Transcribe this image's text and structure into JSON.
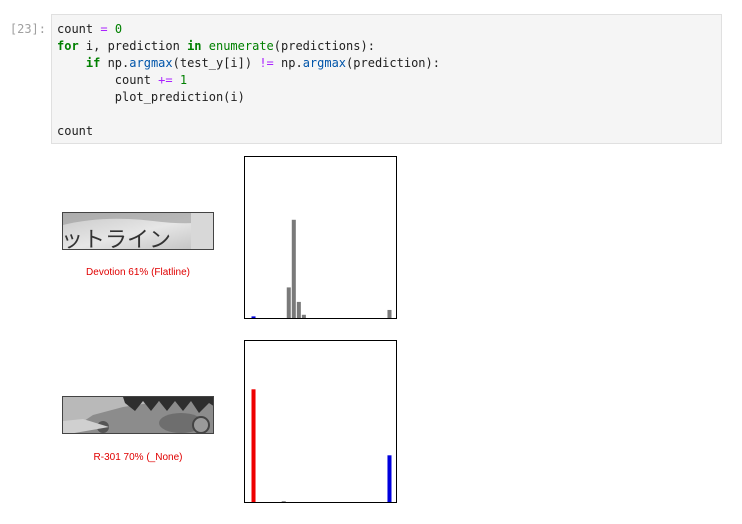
{
  "cell": {
    "prompt": "[23]:",
    "code_lines": [
      [
        {
          "t": "count ",
          "c": ""
        },
        {
          "t": "=",
          "c": "op"
        },
        {
          "t": " ",
          "c": ""
        },
        {
          "t": "0",
          "c": "num"
        }
      ],
      [
        {
          "t": "for",
          "c": "kw"
        },
        {
          "t": " i, prediction ",
          "c": ""
        },
        {
          "t": "in",
          "c": "kw"
        },
        {
          "t": " ",
          "c": ""
        },
        {
          "t": "enumerate",
          "c": "fn"
        },
        {
          "t": "(predictions):",
          "c": ""
        }
      ],
      [
        {
          "t": "    ",
          "c": ""
        },
        {
          "t": "if",
          "c": "kw"
        },
        {
          "t": " np.",
          "c": ""
        },
        {
          "t": "argmax",
          "c": "attr"
        },
        {
          "t": "(test_y[i]) ",
          "c": ""
        },
        {
          "t": "!=",
          "c": "op"
        },
        {
          "t": " np.",
          "c": ""
        },
        {
          "t": "argmax",
          "c": "attr"
        },
        {
          "t": "(prediction):",
          "c": ""
        }
      ],
      [
        {
          "t": "        count ",
          "c": ""
        },
        {
          "t": "+=",
          "c": "op"
        },
        {
          "t": " ",
          "c": ""
        },
        {
          "t": "1",
          "c": "num"
        }
      ],
      [
        {
          "t": "        plot_prediction(i)",
          "c": ""
        }
      ],
      [
        {
          "t": "",
          "c": ""
        }
      ],
      [
        {
          "t": "count",
          "c": ""
        }
      ]
    ]
  },
  "outputs": [
    {
      "caption": "Devotion 61% (Flatline)",
      "thumb_text": "ットライン",
      "bar_colors": [
        "#0000dd",
        "#7a7a7a",
        "#7a7a7a",
        "#7a7a7a",
        "#ee0000",
        "#7a7a7a",
        "#7a7a7a",
        "#7a7a7a",
        "#7a7a7a",
        "#7a7a7a",
        "#7a7a7a",
        "#7a7a7a",
        "#7a7a7a",
        "#7a7a7a",
        "#7a7a7a",
        "#7a7a7a",
        "#7a7a7a",
        "#7a7a7a",
        "#7a7a7a",
        "#7a7a7a",
        "#7a7a7a",
        "#7a7a7a",
        "#7a7a7a",
        "#7a7a7a",
        "#7a7a7a",
        "#7a7a7a",
        "#7a7a7a",
        "#7a7a7a"
      ]
    },
    {
      "caption": "R-301 70% (_None)",
      "thumb_text": "",
      "bar_colors": [
        "#ee0000",
        "#7a7a7a",
        "#7a7a7a",
        "#7a7a7a",
        "#7a7a7a",
        "#7a7a7a",
        "#7a7a7a",
        "#7a7a7a",
        "#7a7a7a",
        "#7a7a7a",
        "#7a7a7a",
        "#7a7a7a",
        "#7a7a7a",
        "#7a7a7a",
        "#7a7a7a",
        "#7a7a7a",
        "#7a7a7a",
        "#7a7a7a",
        "#7a7a7a",
        "#7a7a7a",
        "#7a7a7a",
        "#7a7a7a",
        "#7a7a7a",
        "#7a7a7a",
        "#7a7a7a",
        "#7a7a7a",
        "#7a7a7a",
        "#0000dd"
      ]
    }
  ],
  "chart_data": [
    {
      "type": "bar",
      "n_classes": 28,
      "ylim": [
        0,
        1
      ],
      "values": [
        0.01,
        0,
        0,
        0,
        0,
        0,
        0,
        0.19,
        0.61,
        0.1,
        0.02,
        0,
        0,
        0,
        0,
        0,
        0,
        0,
        0,
        0,
        0,
        0,
        0,
        0,
        0,
        0,
        0,
        0.05
      ],
      "predicted_index": 8,
      "true_index": 0,
      "axes_visible": false
    },
    {
      "type": "bar",
      "n_classes": 28,
      "ylim": [
        0,
        1
      ],
      "values": [
        0.7,
        0,
        0,
        0,
        0,
        0,
        0.005,
        0,
        0,
        0,
        0,
        0,
        0,
        0,
        0,
        0,
        0,
        0,
        0,
        0,
        0,
        0,
        0,
        0,
        0,
        0,
        0,
        0.29
      ],
      "predicted_index": 0,
      "true_index": 27,
      "axes_visible": false
    }
  ]
}
